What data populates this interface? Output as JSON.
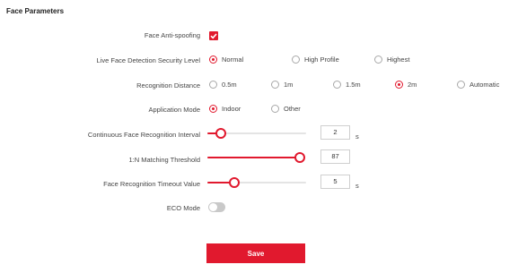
{
  "section_title": "Face Parameters",
  "fields": {
    "anti_spoofing": {
      "label": "Face Anti-spoofing",
      "checked": true
    },
    "security_level": {
      "label": "Live Face Detection Security Level",
      "options": [
        "Normal",
        "High Profile",
        "Highest"
      ],
      "selected": "Normal"
    },
    "recognition_distance": {
      "label": "Recognition Distance",
      "options": [
        "0.5m",
        "1m",
        "1.5m",
        "2m",
        "Automatic"
      ],
      "selected": "2m"
    },
    "application_mode": {
      "label": "Application Mode",
      "options": [
        "Indoor",
        "Other"
      ],
      "selected": "Indoor"
    },
    "continuous_interval": {
      "label": "Continuous Face Recognition Interval",
      "value": "2",
      "unit": "s",
      "fraction": 0.14
    },
    "matching_threshold": {
      "label": "1:N Matching Threshold",
      "value": "87",
      "fraction": 1.0
    },
    "timeout": {
      "label": "Face Recognition Timeout Value",
      "value": "5",
      "unit": "s",
      "fraction": 0.27
    },
    "eco_mode": {
      "label": "ECO Mode",
      "enabled": false
    }
  },
  "save_label": "Save",
  "colors": {
    "accent": "#e1192e",
    "track": "#e4e4e4",
    "toggle_off": "#c9c9c9"
  }
}
